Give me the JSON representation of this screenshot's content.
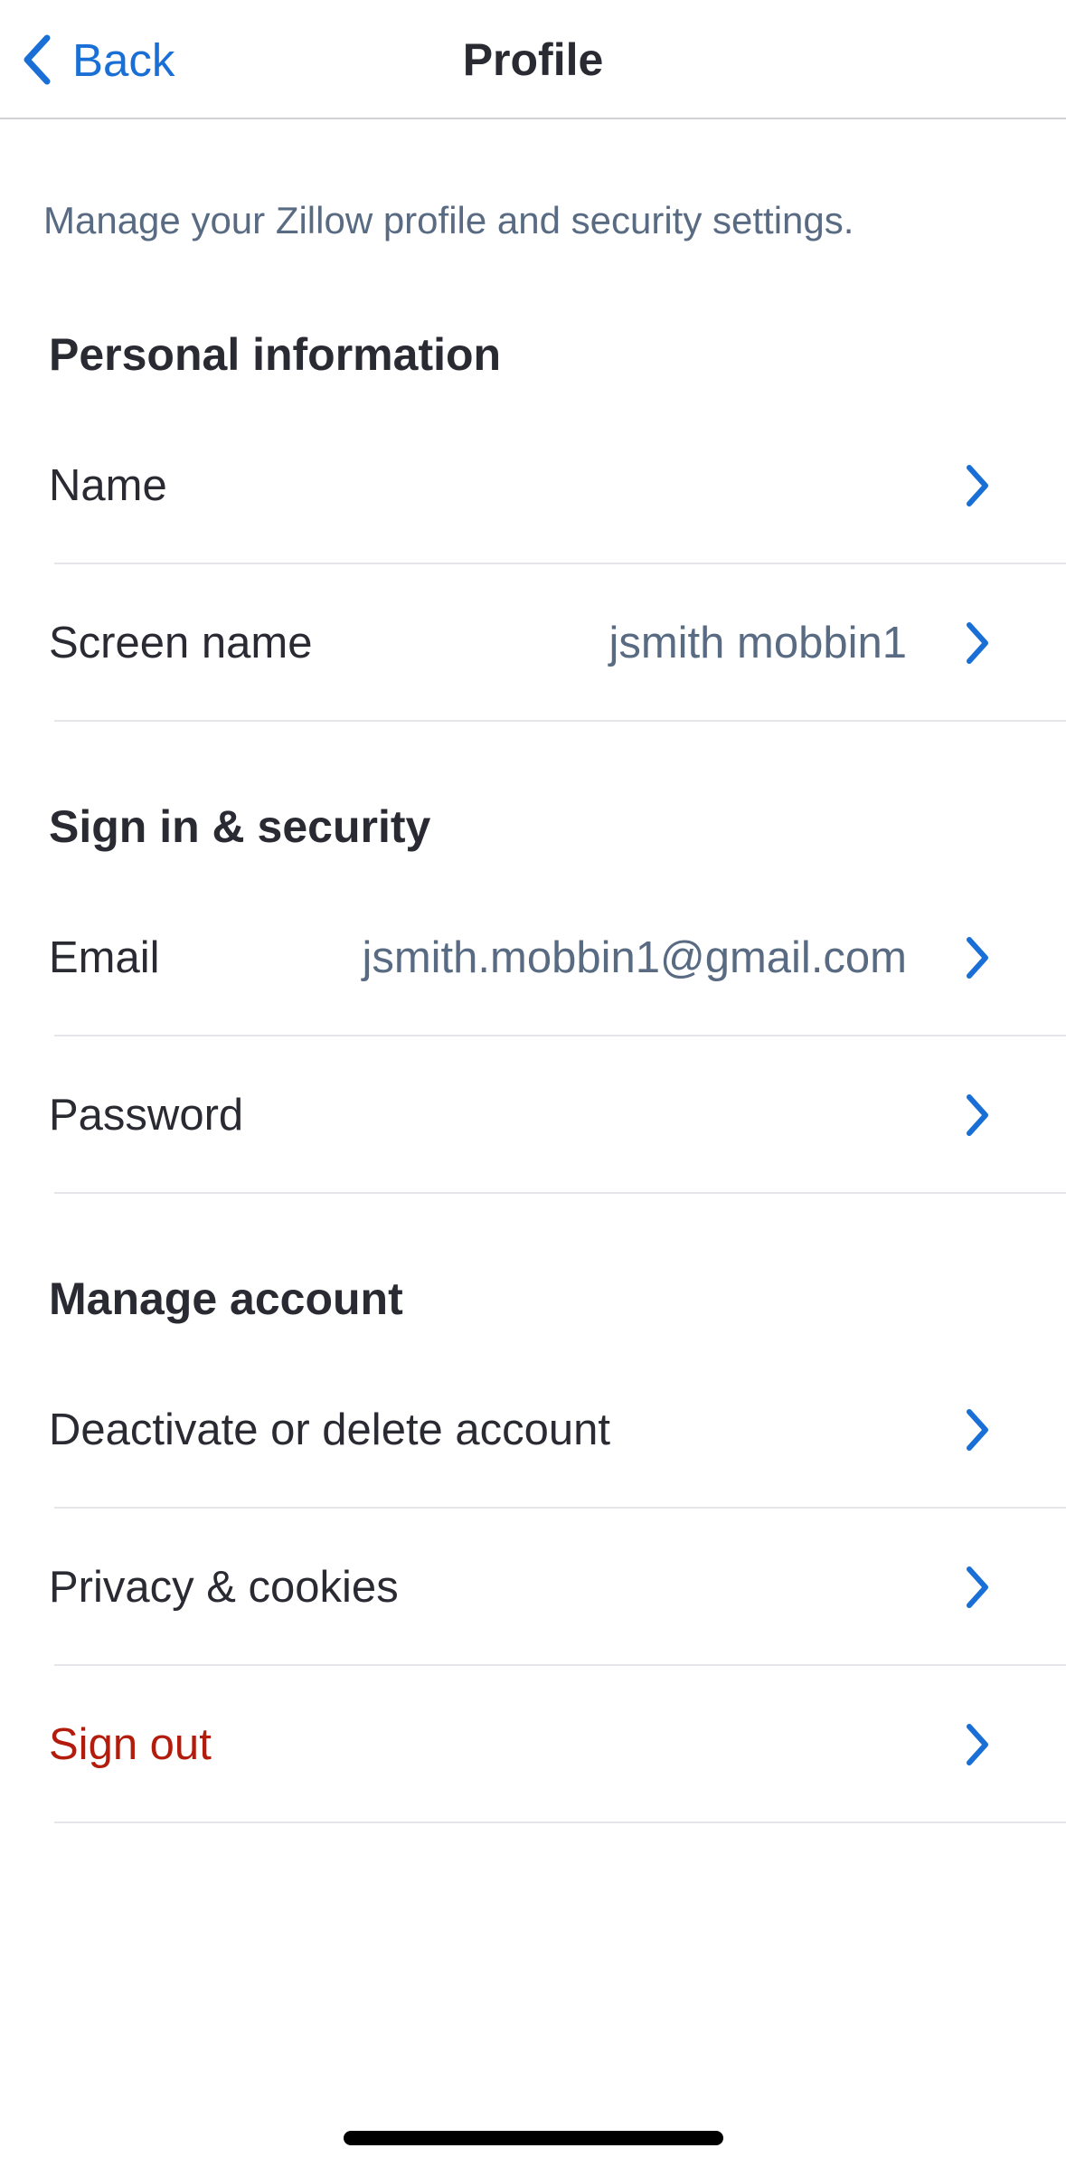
{
  "nav": {
    "back_label": "Back",
    "title": "Profile"
  },
  "intro_text": "Manage your Zillow profile and security settings.",
  "sections": {
    "personal": {
      "heading": "Personal information",
      "name_label": "Name",
      "screen_name_label": "Screen name",
      "screen_name_value": "jsmith mobbin1"
    },
    "security": {
      "heading": "Sign in & security",
      "email_label": "Email",
      "email_value": "jsmith.mobbin1@gmail.com",
      "password_label": "Password"
    },
    "manage": {
      "heading": "Manage account",
      "deactivate_label": "Deactivate or delete account",
      "privacy_label": "Privacy & cookies",
      "signout_label": "Sign out"
    }
  },
  "icons": {
    "back": "chevron-left-icon",
    "row_chevron": "chevron-right-icon"
  },
  "colors": {
    "accent": "#1a6fd6",
    "danger": "#b31c0c",
    "secondary_text": "#596b82",
    "primary_text": "#2a2a33"
  }
}
